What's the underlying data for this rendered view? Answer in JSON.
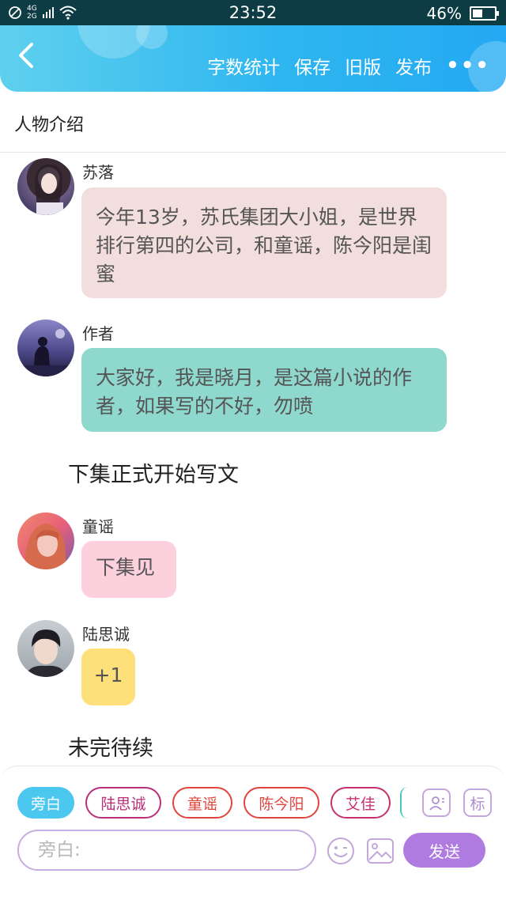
{
  "status_bar": {
    "network_top": "4G",
    "network_bottom": "2G",
    "time": "23:52",
    "battery": "46%",
    "battery_level": 0.46
  },
  "navbar": {
    "actions": [
      "字数统计",
      "保存",
      "旧版",
      "发布"
    ],
    "more": "•••"
  },
  "section_title": "人物介绍",
  "messages": [
    {
      "name": "苏落",
      "text": "今年13岁，苏氏集团大小姐，是世界排行第四的公司，和童谣，陈今阳是闺蜜",
      "bubble_color": "#f3dede"
    },
    {
      "name": "作者",
      "text": "大家好，我是晓月，是这篇小说的作者，如果写的不好，勿喷",
      "bubble_color": "#8fd8cd"
    },
    {
      "narration": "下集正式开始写文"
    },
    {
      "name": "童谣",
      "text": "下集见",
      "bubble_color": "#fcd0dc"
    },
    {
      "name": "陆思诚",
      "text": "+1",
      "bubble_color": "#fde07a"
    },
    {
      "narration": "未完待续"
    }
  ],
  "composer": {
    "chips": [
      {
        "label": "旁白",
        "active": true,
        "color": "#4cc8f0"
      },
      {
        "label": "陆思诚",
        "active": false,
        "color": "#b8307a"
      },
      {
        "label": "童谣",
        "active": false,
        "color": "#e0443c"
      },
      {
        "label": "陈今阳",
        "active": false,
        "color": "#e0443c"
      },
      {
        "label": "艾佳",
        "active": false,
        "color": "#c8306e"
      }
    ],
    "tag_button": "标",
    "input_placeholder": "旁白:",
    "send_label": "发送"
  },
  "colors": {
    "nav_gradient_start": "#5fd0ee",
    "nav_gradient_end": "#24a9f2",
    "send_button": "#b07be0",
    "icon_outline": "#c3a6dc"
  }
}
